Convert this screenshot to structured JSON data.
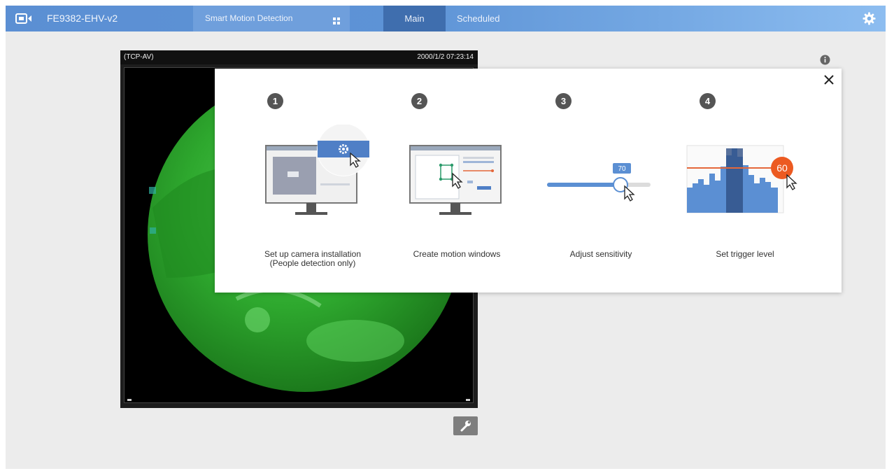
{
  "header": {
    "model_name": "FE9382-EHV-v2",
    "app_tab_label": "Smart Motion Detection",
    "tabs": [
      {
        "label": "Main",
        "active": true
      },
      {
        "label": "Scheduled",
        "active": false
      }
    ]
  },
  "video": {
    "camera_label": "(TCP-AV)",
    "timestamp": "2000/1/2 07:23:14"
  },
  "wizard": {
    "steps": [
      {
        "number": "1",
        "label_line1": "Set up camera installation",
        "label_line2": "(People detection only)"
      },
      {
        "number": "2",
        "label_line1": "Create motion windows",
        "label_line2": ""
      },
      {
        "number": "3",
        "label_line1": "Adjust sensitivity",
        "label_line2": ""
      },
      {
        "number": "4",
        "label_line1": "Set trigger level",
        "label_line2": ""
      }
    ],
    "sensitivity_value": "70",
    "trigger_value": "60"
  },
  "colors": {
    "header_blue": "#5b8fd3",
    "active_tab": "#3f6eae",
    "slider_blue": "#5b8fd3",
    "trigger_orange": "#ec5a21",
    "fisheye_green": "#2ea82e"
  },
  "icons": [
    "logo-icon",
    "grid-icon",
    "gear-icon",
    "info-icon",
    "close-icon",
    "wrench-icon",
    "cursor-icon"
  ]
}
